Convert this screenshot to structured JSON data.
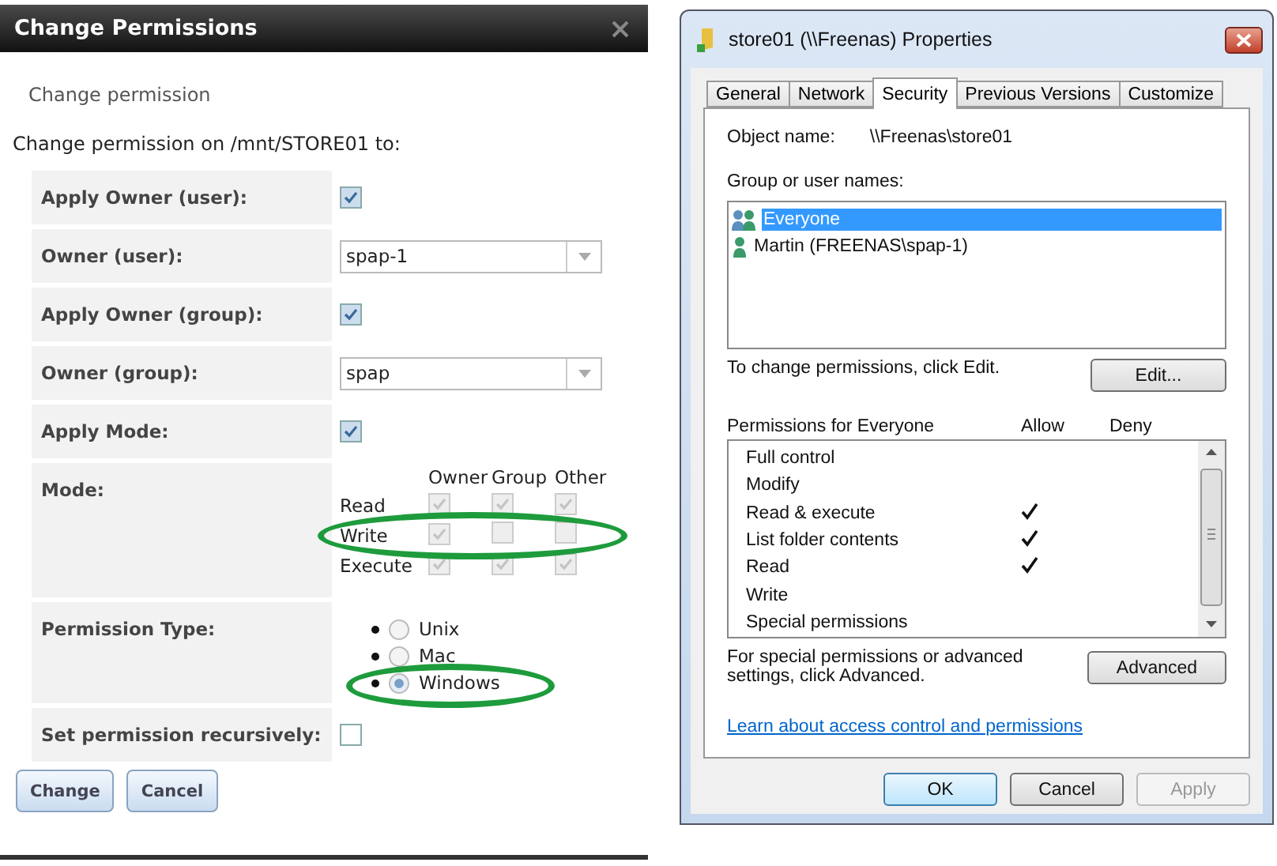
{
  "freenas_dialog": {
    "title": "Change Permissions",
    "heading": "Change permission",
    "intro": "Change permission on /mnt/STORE01 to:",
    "fields": [
      {
        "kind": "checkbox",
        "label": "Apply Owner (user):",
        "checked": true
      },
      {
        "kind": "select",
        "label": "Owner (user):",
        "value": "spap-1"
      },
      {
        "kind": "checkbox",
        "label": "Apply Owner (group):",
        "checked": true
      },
      {
        "kind": "select",
        "label": "Owner (group):",
        "value": "spap"
      },
      {
        "kind": "checkbox",
        "label": "Apply Mode:",
        "checked": true
      },
      {
        "kind": "mode",
        "label": "Mode:",
        "columns": [
          "Owner",
          "Group",
          "Other"
        ],
        "rows": [
          {
            "label": "Read",
            "highlighted": false,
            "bits": [
              {
                "checked": true
              },
              {
                "checked": true
              },
              {
                "checked": true
              }
            ]
          },
          {
            "label": "Write",
            "highlighted": true,
            "bits": [
              {
                "checked": true
              },
              {
                "checked": false
              },
              {
                "checked": false
              }
            ]
          },
          {
            "label": "Execute",
            "highlighted": false,
            "bits": [
              {
                "checked": true
              },
              {
                "checked": true
              },
              {
                "checked": true
              }
            ]
          }
        ]
      },
      {
        "kind": "radio",
        "label": "Permission Type:",
        "options": [
          {
            "label": "Unix",
            "selected": false,
            "highlighted": false
          },
          {
            "label": "Mac",
            "selected": false,
            "highlighted": false
          },
          {
            "label": "Windows",
            "selected": true,
            "highlighted": true
          }
        ]
      },
      {
        "kind": "checkbox",
        "label": "Set permission recursively:",
        "checked": false
      }
    ],
    "buttons": [
      "Change",
      "Cancel"
    ]
  },
  "properties_window": {
    "title": "store01 (\\\\Freenas) Properties",
    "tabs": [
      {
        "label": "General",
        "selected": false
      },
      {
        "label": "Network",
        "selected": false
      },
      {
        "label": "Security",
        "selected": true
      },
      {
        "label": "Previous Versions",
        "selected": false
      },
      {
        "label": "Customize",
        "selected": false
      }
    ],
    "object_name_label": "Object name:",
    "object_name": "\\\\Freenas\\store01",
    "groups_label": "Group or user names:",
    "users": [
      {
        "kind": "group",
        "name": "Everyone",
        "selected": true
      },
      {
        "kind": "user",
        "name": "Martin (FREENAS\\spap-1)",
        "selected": false
      }
    ],
    "edit_hint": "To change permissions, click Edit.",
    "edit_button": "Edit...",
    "permissions_title": "Permissions for Everyone",
    "allow_label": "Allow",
    "deny_label": "Deny",
    "permissions": [
      {
        "name": "Full control",
        "allow": false,
        "deny": false
      },
      {
        "name": "Modify",
        "allow": false,
        "deny": false
      },
      {
        "name": "Read & execute",
        "allow": true,
        "deny": false
      },
      {
        "name": "List folder contents",
        "allow": true,
        "deny": false
      },
      {
        "name": "Read",
        "allow": true,
        "deny": false
      },
      {
        "name": "Write",
        "allow": false,
        "deny": false
      },
      {
        "name": "Special permissions",
        "allow": false,
        "deny": false
      }
    ],
    "advanced_hint": "For special permissions or advanced settings, click Advanced.",
    "advanced_button": "Advanced",
    "link": "Learn about access control and permissions",
    "buttons": [
      {
        "label": "OK",
        "default": true,
        "disabled": false
      },
      {
        "label": "Cancel",
        "default": false,
        "disabled": false
      },
      {
        "label": "Apply",
        "default": false,
        "disabled": true
      }
    ]
  }
}
